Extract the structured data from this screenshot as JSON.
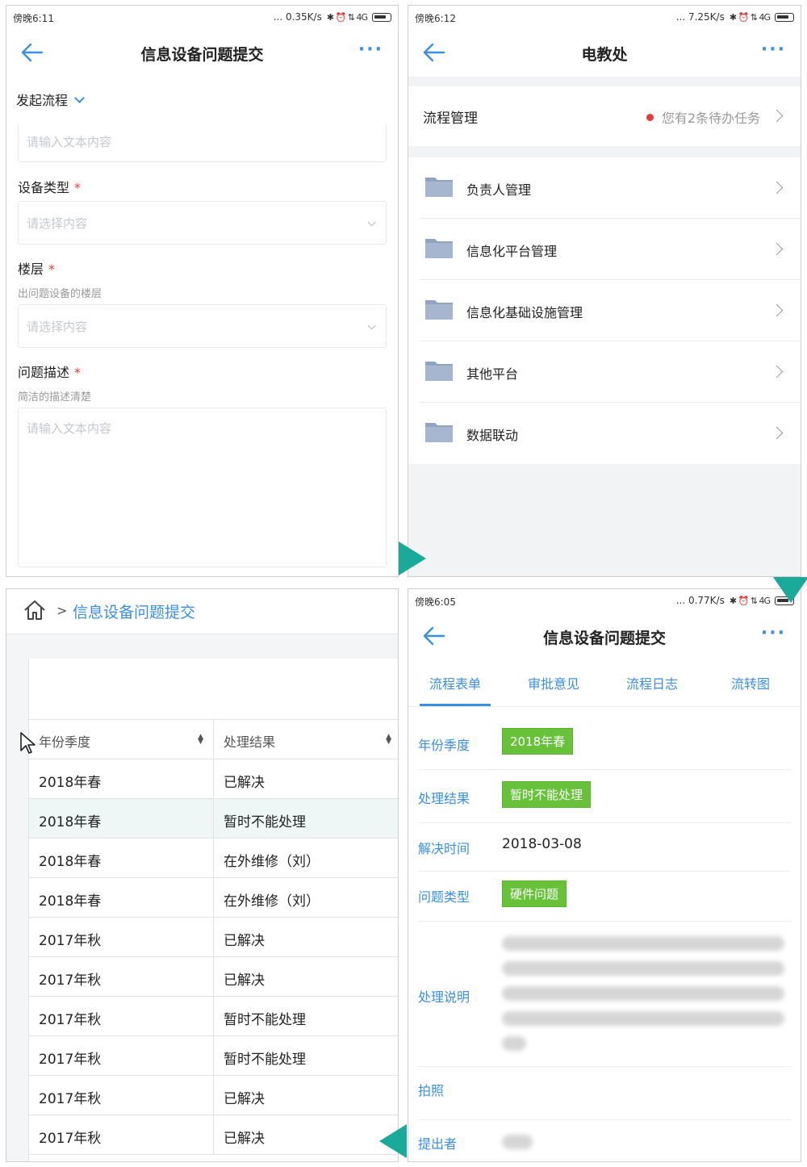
{
  "screen1": {
    "status": {
      "time": "傍晚6:11",
      "net": "... 0.35K/s",
      "icons": "✱ ⏰ ⇅ 4G"
    },
    "title": "信息设备问题提交",
    "more": "···",
    "launch_label": "发起流程",
    "top_input_placeholder": "请输入文本内容",
    "device_type_label": "设备类型",
    "device_type_placeholder": "请选择内容",
    "floor_label": "楼层",
    "floor_hint": "出问题设备的楼层",
    "floor_placeholder": "请选择内容",
    "desc_label": "问题描述",
    "desc_hint": "简洁的描述清楚",
    "desc_placeholder": "请输入文本内容",
    "required_mark": "*"
  },
  "screen2": {
    "status": {
      "time": "傍晚6:12",
      "net": "... 7.25K/s",
      "icons": "✱ ⏰ ⇅ 4G"
    },
    "title": "电教处",
    "more": "···",
    "process_label": "流程管理",
    "pending_text": "您有2条待办任务",
    "folders": [
      {
        "name": "负责人管理"
      },
      {
        "name": "信息化平台管理"
      },
      {
        "name": "信息化基础设施管理"
      },
      {
        "name": "其他平台"
      },
      {
        "name": "数据联动"
      }
    ]
  },
  "screen3": {
    "breadcrumb_sep": ">",
    "breadcrumb_title": "信息设备问题提交",
    "columns": [
      "年份季度",
      "处理结果"
    ],
    "rows": [
      [
        "2018年春",
        "已解决"
      ],
      [
        "2018年春",
        "暂时不能处理"
      ],
      [
        "2018年春",
        "在外维修（刘）"
      ],
      [
        "2018年春",
        "在外维修（刘）"
      ],
      [
        "2017年秋",
        "已解决"
      ],
      [
        "2017年秋",
        "已解决"
      ],
      [
        "2017年秋",
        "暂时不能处理"
      ],
      [
        "2017年秋",
        "暂时不能处理"
      ],
      [
        "2017年秋",
        "已解决"
      ],
      [
        "2017年秋",
        "已解决"
      ]
    ],
    "highlighted_row": 1
  },
  "screen4": {
    "status": {
      "time": "傍晚6:05",
      "net": "... 0.77K/s",
      "icons": "✱ ⏰ ⇅ 4G"
    },
    "title": "信息设备问题提交",
    "more": "···",
    "tabs": [
      "流程表单",
      "审批意见",
      "流程日志",
      "流转图"
    ],
    "fields": {
      "season_label": "年份季度",
      "season_value": "2018年春",
      "result_label": "处理结果",
      "result_value": "暂时不能处理",
      "time_label": "解决时间",
      "time_value": "2018-03-08",
      "type_label": "问题类型",
      "type_value": "硬件问题",
      "note_label": "处理说明",
      "photo_label": "拍照",
      "submitter_label": "提出者"
    },
    "tag_color": "#67c23a",
    "accent": "#3a8ee6"
  },
  "colors": {
    "arrow": "#1aaa9a",
    "required": "#e63b3b"
  }
}
